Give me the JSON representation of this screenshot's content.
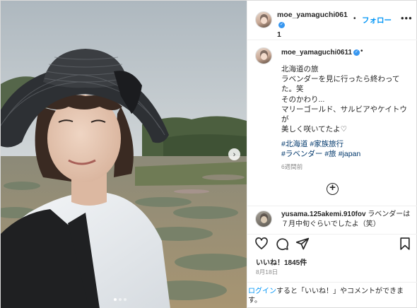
{
  "post": {
    "username_line1": "moe_yamaguchi061",
    "username_line2": "1",
    "username": "moe_yamaguchi0611",
    "separator": "•",
    "follow_label": "フォロー",
    "more_glyph": "•••",
    "verified_glyph": "✓"
  },
  "caption": {
    "lines": [
      "北海道の旅",
      "ラベンダーを見に行ったら終わって",
      "た。笑",
      "そのかわり...",
      "マリーゴールド、サルビアやケイトウ",
      "が",
      "美しく咲いてたよ♡"
    ],
    "hashtags": [
      "#北海道",
      "#家族旅行",
      "#ラベンダー",
      "#旅",
      "#japan"
    ],
    "time_ago": "6週間前"
  },
  "load_more_glyph": "+",
  "comment": {
    "username": "yusama.125akemi.910fov",
    "text": "ラベンダーは７月中旬ぐらいでしたよ（笑）"
  },
  "likes_text": "いいね！1845件",
  "date_text": "8月18日",
  "login_prompt": {
    "link": "ログイン",
    "rest": "すると「いいね！」やコメントができます。"
  },
  "carousel": {
    "next_glyph": "›",
    "dot_count": 3,
    "active_dot": 0
  },
  "icons": {
    "like": "heart-icon",
    "comment": "comment-icon",
    "share": "share-icon",
    "save": "bookmark-icon"
  },
  "colors": {
    "accent": "#0095f6",
    "hashtag": "#00376b",
    "muted": "#8e8e8e",
    "text": "#262626"
  }
}
